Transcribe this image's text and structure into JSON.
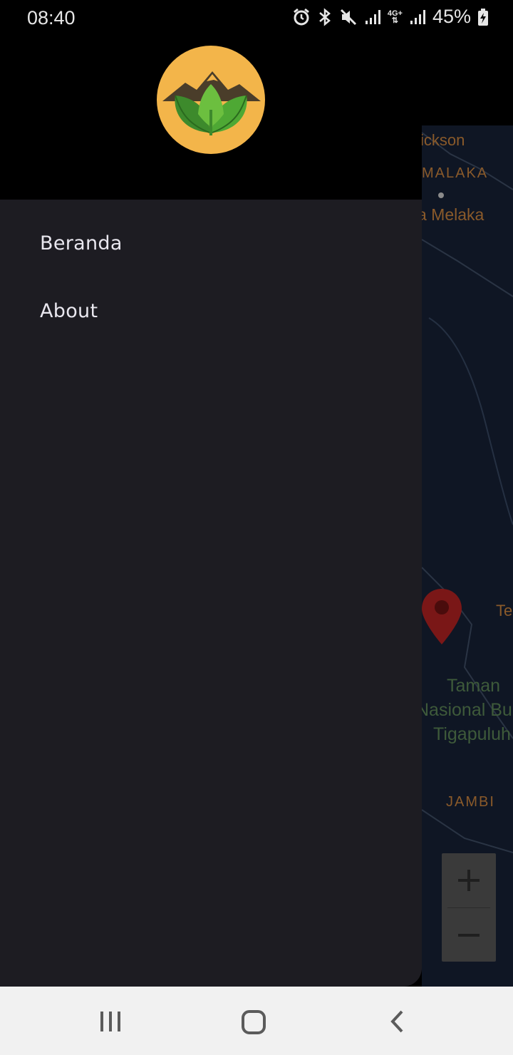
{
  "status_bar": {
    "time": "08:40",
    "battery": "45%",
    "network_label": "4G+",
    "icons": [
      "alarm-icon",
      "bluetooth-icon",
      "mute-icon",
      "signal-icon",
      "network-4g-icon",
      "signal-icon",
      "battery-charging-icon"
    ]
  },
  "drawer": {
    "logo": "mountain-leaves-logo",
    "items": [
      {
        "label": "Beranda"
      },
      {
        "label": "About"
      }
    ]
  },
  "map": {
    "labels": {
      "l1": "ickson",
      "l2": "MALAKA",
      "l3": "a Melaka",
      "l4": "Te",
      "l5": "Taman",
      "l6": "Nasional Bu",
      "l7": "Tigapuluh",
      "l8": "JAMBI"
    },
    "zoom_in": "+",
    "zoom_out": "−",
    "pin_color": "#8b1a1a"
  },
  "nav_bar": {
    "icons": [
      "recent-apps-icon",
      "home-icon",
      "back-icon"
    ]
  }
}
